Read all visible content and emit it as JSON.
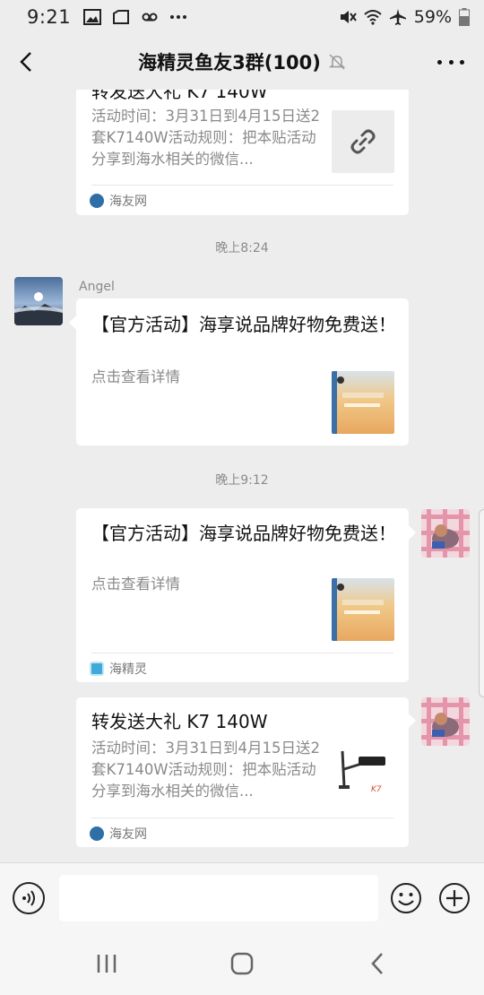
{
  "status_bar": {
    "time": "9:21",
    "left_icons": [
      "image-icon",
      "folder-icon",
      "voicemail-icon",
      "more-dots-icon"
    ],
    "right_icons": [
      "mute-icon",
      "wifi-icon",
      "airplane-icon"
    ],
    "battery": "59%"
  },
  "header": {
    "title": "海精灵鱼友3群(100)",
    "icons": [
      "back-icon",
      "muted-bell-icon",
      "more-icon"
    ]
  },
  "messages": [
    {
      "kind": "link-card",
      "partial_title": "转发送大礼 K7 140W",
      "desc": "活动时间：3月31日到4月15日送2套K7140W活动规则：把本贴活动分享到海水相关的微信...",
      "source": "海友网",
      "thumb": "link-icon"
    },
    {
      "kind": "time",
      "text": "晚上8:24"
    },
    {
      "kind": "link-card",
      "sender": "Angel",
      "title": "【官方活动】海享说品牌好物免费送！",
      "desc": "点击查看详情"
    },
    {
      "kind": "time",
      "text": "晚上9:12"
    },
    {
      "kind": "link-card",
      "title": "【官方活动】海享说品牌好物免费送！",
      "desc": "点击查看详情",
      "source": "海精灵"
    },
    {
      "kind": "link-card",
      "title": "转发送大礼 K7 140W",
      "desc": "活动时间：3月31日到4月15日送2套K7140W活动规则：把本贴活动分享到海水相关的微信...",
      "source": "海友网"
    }
  ],
  "input_bar": {
    "placeholder": "",
    "icons": [
      "voice-icon",
      "emoji-icon",
      "plus-icon"
    ]
  },
  "nav_bar": {
    "icons": [
      "recents-icon",
      "home-icon",
      "nav-back-icon"
    ]
  },
  "colors": {
    "background": "#ededed",
    "card": "#ffffff",
    "muted_text": "#8a8a8a",
    "source_blue": "#2f6fa8"
  }
}
